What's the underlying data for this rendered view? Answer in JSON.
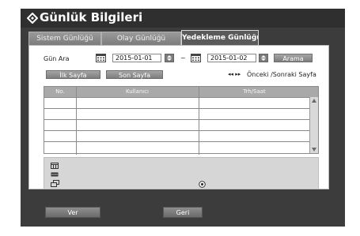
{
  "window": {
    "title": "Günlük Bilgileri"
  },
  "tabs": [
    {
      "label": "Sistem Günlüğü"
    },
    {
      "label": "Olay Günlüğü"
    },
    {
      "label": "Yedekleme Günlüğü"
    }
  ],
  "search": {
    "range_label": "Gün Ara",
    "start_date": "2015-01-01",
    "separator": "~",
    "end_date": "2015-01-02",
    "search_button": "Arama"
  },
  "paging": {
    "first_page": "İlk Sayfa",
    "last_page": "Son Sayfa",
    "arrows": "◂◂ ▸▸",
    "prev_next": "Önceki /Sonraki Sayfa"
  },
  "table": {
    "columns": [
      "No.",
      "Kullanıcı",
      "Trh/Saat"
    ],
    "rows": [
      [
        "",
        "",
        ""
      ],
      [
        "",
        "",
        ""
      ],
      [
        "",
        "",
        ""
      ],
      [
        "",
        "",
        ""
      ],
      [
        "",
        "",
        ""
      ]
    ]
  },
  "footer": {
    "view_button": "Ver",
    "back_button": "Geri"
  },
  "colors": {
    "window_bg": "#3c3c3c",
    "active_tab": "#5a5a5a",
    "button": "#8a8a8a"
  }
}
